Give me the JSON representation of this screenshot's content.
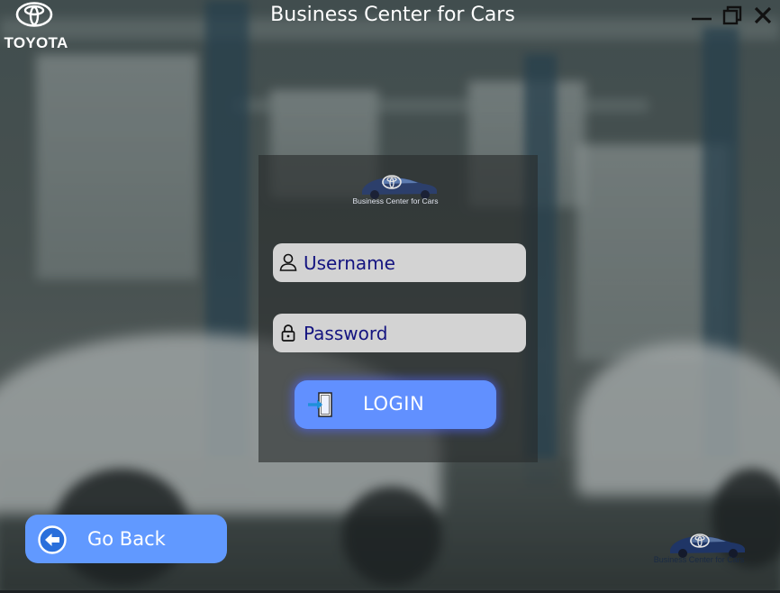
{
  "window": {
    "title": "Business Center for Cars",
    "brand_name": "TOYOTA",
    "brand_icon": "toyota-logo-icon",
    "controls": [
      "minimize-icon",
      "maximize-icon",
      "close-icon"
    ]
  },
  "login_card": {
    "logo_caption": "Business Center for Cars",
    "username": {
      "placeholder": "Username",
      "value": "",
      "icon": "user-icon"
    },
    "password": {
      "placeholder": "Password",
      "value": "",
      "icon": "lock-icon"
    },
    "login_button": {
      "label": "LOGIN",
      "icon": "login-door-icon"
    }
  },
  "go_back_button": {
    "label": "Go Back",
    "icon": "arrow-left-circle-icon"
  },
  "corner_logo": {
    "caption": "Business Center for Cars"
  },
  "colors": {
    "button_blue": "#6190ff",
    "field_bg": "#d3d3d3",
    "placeholder_text": "#141480",
    "title_text": "#ffffff"
  }
}
